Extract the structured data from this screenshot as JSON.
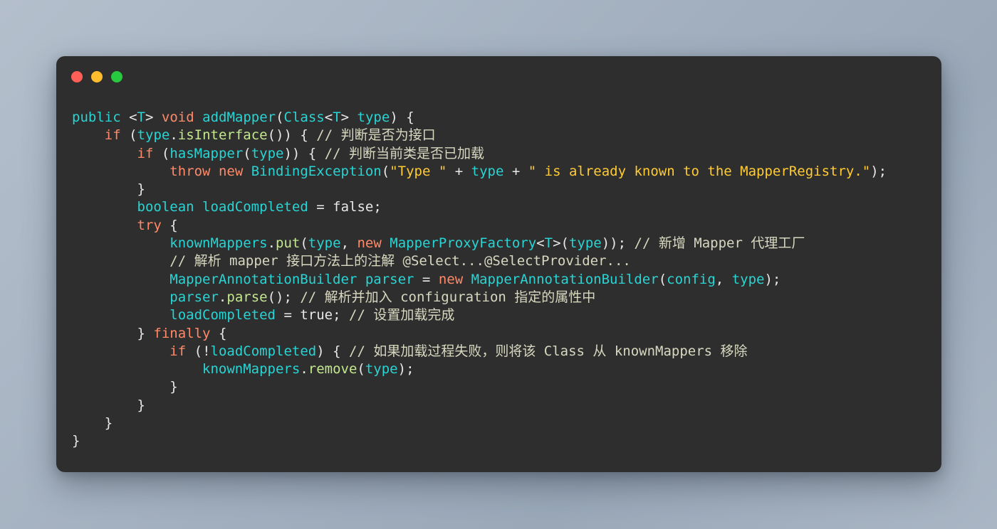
{
  "window": {
    "title": "",
    "controls": [
      {
        "name": "close",
        "color": "#ff5f56"
      },
      {
        "name": "minimize",
        "color": "#ffbd2e"
      },
      {
        "name": "maximize",
        "color": "#27c93f"
      }
    ],
    "background_color": "#2e2e2e",
    "desktop_background": "#a8b4c4"
  },
  "editor": {
    "language": "java",
    "theme": {
      "keyword": "#ff8a6a",
      "type": "#29d4d4",
      "function": "#c3e88d",
      "string": "#ffcb34",
      "comment": "#d8d8c0",
      "plain": "#e8e8e8",
      "background": "#2e2e2e"
    },
    "lines": [
      "public <T> void addMapper(Class<T> type) {",
      "    if (type.isInterface()) { // 判断是否为接口",
      "        if (hasMapper(type)) { // 判断当前类是否已加载",
      "            throw new BindingException(\"Type \" + type + \" is already known to the MapperRegistry.\");",
      "        }",
      "        boolean loadCompleted = false;",
      "        try {",
      "            knownMappers.put(type, new MapperProxyFactory<T>(type)); // 新增 Mapper 代理工厂",
      "            // 解析 mapper 接口方法上的注解 @Select...@SelectProvider...",
      "            MapperAnnotationBuilder parser = new MapperAnnotationBuilder(config, type);",
      "            parser.parse(); // 解析并加入 configuration 指定的属性中",
      "            loadCompleted = true; // 设置加载完成",
      "        } finally {",
      "            if (!loadCompleted) { // 如果加载过程失败，则将该 Class 从 knownMappers 移除",
      "                knownMappers.remove(type);",
      "            }",
      "        }",
      "    }",
      "}"
    ],
    "comments": [
      "// 判断是否为接口",
      "// 判断当前类是否已加载",
      "// 新增 Mapper 代理工厂",
      "// 解析 mapper 接口方法上的注解 @Select...@SelectProvider...",
      "// 解析并加入 configuration 指定的属性中",
      "// 设置加载完成",
      "// 如果加载过程失败，则将该 Class 从 knownMappers 移除"
    ],
    "strings": [
      "\"Type \"",
      "\" is already known to the MapperRegistry.\""
    ],
    "method_name": "addMapper"
  }
}
